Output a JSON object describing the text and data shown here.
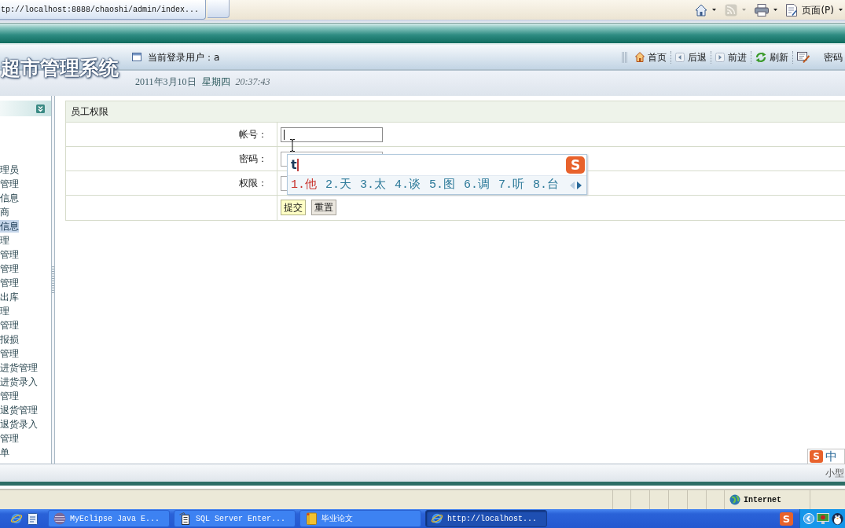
{
  "browser": {
    "tab_title": "tp://localhost:8888/chaoshi/admin/index...",
    "commands": [
      {
        "kind": "home",
        "disabled": false
      },
      {
        "kind": "feeds",
        "disabled": true
      },
      {
        "kind": "print",
        "disabled": false
      },
      {
        "kind": "page",
        "label": "页面(P)",
        "disabled": false
      }
    ]
  },
  "header": {
    "logo": "超市管理系统",
    "current_user": "当前登录用户：a",
    "date": "2011年3月10日",
    "weekday": "星期四",
    "time": "20:37:43",
    "toolbar": [
      {
        "kind": "home",
        "label": "首页"
      },
      {
        "kind": "back",
        "label": "后退"
      },
      {
        "kind": "forward",
        "label": "前进"
      },
      {
        "kind": "refresh",
        "label": "刷新"
      },
      {
        "kind": "password",
        "label": "密码"
      }
    ]
  },
  "sidebar": {
    "items": [
      {
        "label": "理员",
        "selected": false
      },
      {
        "label": "管理",
        "selected": false
      },
      {
        "label": "信息",
        "selected": false
      },
      {
        "label": "商",
        "selected": false
      },
      {
        "label": "信息",
        "selected": true
      },
      {
        "label": "理",
        "selected": false
      },
      {
        "label": "管理",
        "selected": false
      },
      {
        "label": "管理",
        "selected": false
      },
      {
        "label": "管理",
        "selected": false
      },
      {
        "label": "出库",
        "selected": false
      },
      {
        "label": "理",
        "selected": false
      },
      {
        "label": "管理",
        "selected": false
      },
      {
        "label": "报损",
        "selected": false
      },
      {
        "label": "管理",
        "selected": false
      },
      {
        "label": "进货管理",
        "selected": false
      },
      {
        "label": "进货录入",
        "selected": false
      },
      {
        "label": "管理",
        "selected": false
      },
      {
        "label": "退货管理",
        "selected": false
      },
      {
        "label": "退货录入",
        "selected": false
      },
      {
        "label": "管理",
        "selected": false
      },
      {
        "label": "单",
        "selected": false
      }
    ]
  },
  "form": {
    "title": "员工权限",
    "fields": [
      {
        "label": "帐号：",
        "focused": true
      },
      {
        "label": "密码：",
        "focused": false
      },
      {
        "label": "权限：",
        "focused": false
      }
    ],
    "buttons": [
      {
        "kind": "submit",
        "label": "提交"
      },
      {
        "kind": "reset",
        "label": "重置"
      }
    ]
  },
  "ime_popup": {
    "composition": "t",
    "logo": "S",
    "candidates": [
      {
        "label": "1.他",
        "selected": true
      },
      {
        "label": "2.天",
        "selected": false
      },
      {
        "label": "3.太",
        "selected": false
      },
      {
        "label": "4.谈",
        "selected": false
      },
      {
        "label": "5.图",
        "selected": false
      },
      {
        "label": "6.调",
        "selected": false
      },
      {
        "label": "7.听",
        "selected": false
      },
      {
        "label": "8.台",
        "selected": false
      }
    ],
    "paging": {
      "prev_enabled": false,
      "next_enabled": true
    }
  },
  "ime_status": {
    "logo": "S",
    "mode": "中"
  },
  "footer": {
    "text": "小型"
  },
  "status_bar": {
    "zone": "Internet"
  },
  "taskbar": {
    "buttons": [
      {
        "kind": "sphere",
        "label": "MyEclipse Java E...",
        "selected": false
      },
      {
        "kind": "server",
        "label": "SQL Server Enter...",
        "selected": false
      },
      {
        "kind": "notebook",
        "label": "毕业论文",
        "selected": false
      },
      {
        "kind": "globe",
        "label": "http://localhost...",
        "selected": true
      }
    ],
    "tray_logo": "S"
  }
}
